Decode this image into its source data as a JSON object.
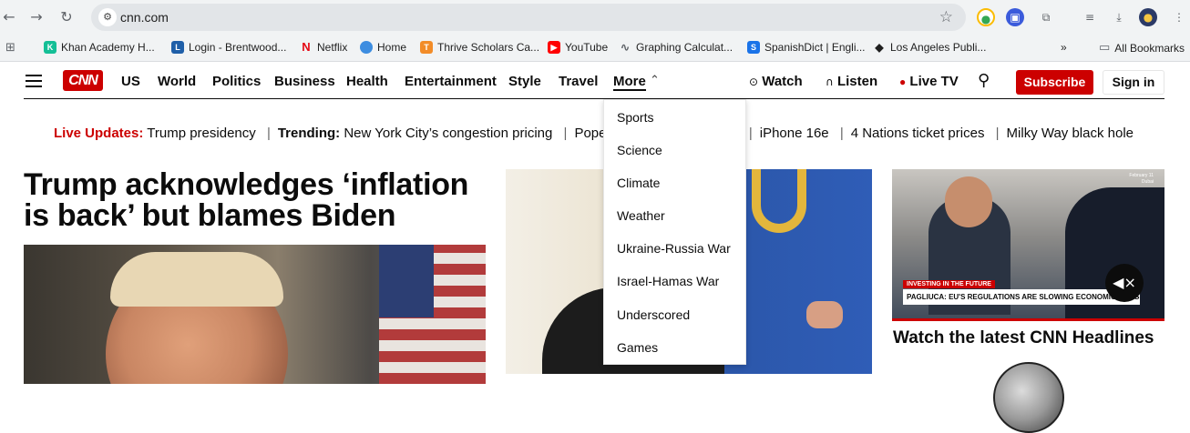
{
  "browser": {
    "url": "cnn.com",
    "bookmarks": [
      "Khan Academy H...",
      "Login - Brentwood...",
      "Netflix",
      "Home",
      "Thrive Scholars Ca...",
      "YouTube",
      "Graphing Calculat...",
      "SpanishDict | Engli...",
      "Los Angeles Publi..."
    ],
    "overflow": "»",
    "all_bookmarks": "All Bookmarks"
  },
  "nav": {
    "links": [
      "US",
      "World",
      "Politics",
      "Business",
      "Health",
      "Entertainment",
      "Style",
      "Travel"
    ],
    "more": "More",
    "watch": "Watch",
    "listen": "Listen",
    "live_tv": "Live TV",
    "subscribe": "Subscribe",
    "sign_in": "Sign in"
  },
  "trending": {
    "live_label": "Live Updates:",
    "live_topic": "Trump presidency",
    "trending_label": "Trending:",
    "items": [
      "New York City’s congestion pricing",
      "Pope",
      "iPhone 16e",
      "4 Nations ticket prices",
      "Milky Way black hole"
    ]
  },
  "more_menu": [
    "Sports",
    "Science",
    "Climate",
    "Weather",
    "Ukraine-Russia War",
    "Israel-Hamas War",
    "Underscored",
    "Games"
  ],
  "main": {
    "headline": "Trump acknowledges ‘inflation is back’ but blames Biden",
    "video_title": "Watch the latest CNN Headlines",
    "video_date": "February 11",
    "video_place": "Dubai",
    "video_topbar": "INVESTING IN THE FUTURE",
    "video_chyron": "PAGLIUCA: EU'S REGULATIONS ARE SLOWING ECONOMIC PROGRESS"
  },
  "colors": {
    "cnn_red": "#cc0000"
  }
}
